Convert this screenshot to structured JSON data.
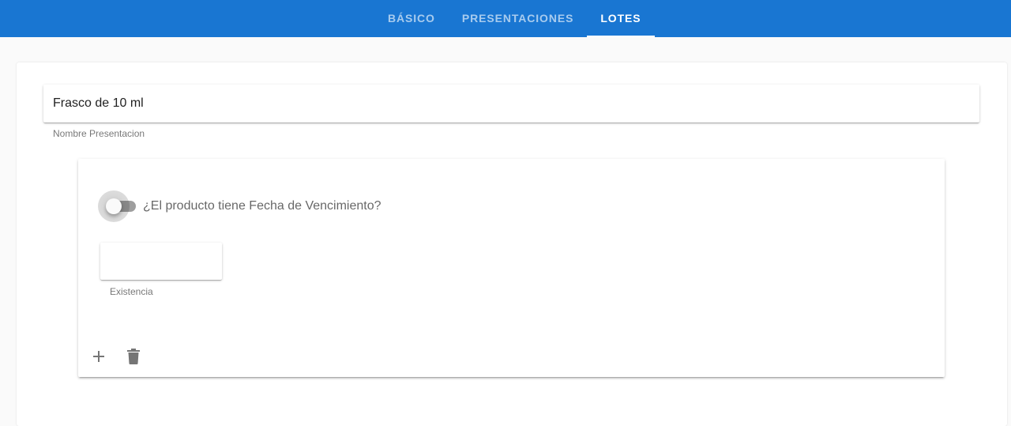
{
  "tabs": [
    {
      "label": "Básico",
      "active": false
    },
    {
      "label": "Presentaciones",
      "active": false
    },
    {
      "label": "Lotes",
      "active": true
    }
  ],
  "presentation": {
    "name_value": "Frasco de 10 ml",
    "name_hint": "Nombre Presentacion"
  },
  "lot": {
    "expiry_toggle_label": "¿El producto tiene Fecha de Vencimiento?",
    "expiry_toggle_on": false,
    "stock_value": "",
    "stock_hint": "Existencia"
  },
  "actions": {
    "add_icon": "plus-icon",
    "delete_icon": "trash-icon"
  },
  "colors": {
    "primary": "#1976d2",
    "icon": "#757575"
  }
}
